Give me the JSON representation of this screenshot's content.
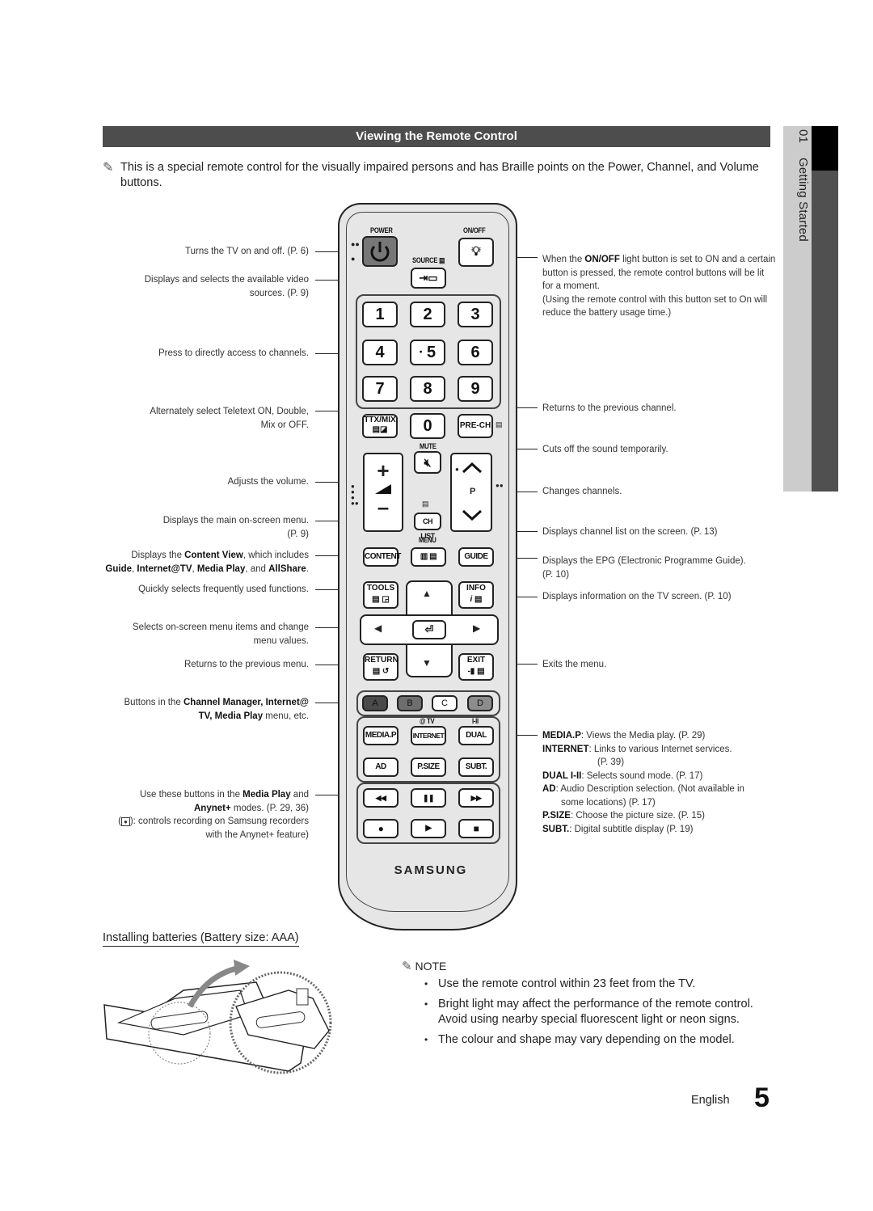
{
  "section": {
    "title": "Viewing the Remote Control",
    "intro_icon": "pencil-note-icon",
    "intro": "This is a special remote control for the visually impaired persons and has Braille points on the Power, Channel, and Volume buttons."
  },
  "side_tab": {
    "chapter_number": "01",
    "chapter_title": "Getting Started"
  },
  "left_callouts": [
    {
      "text": "Turns the TV on and off. (P. 6)"
    },
    {
      "line1": "Displays and selects the available video",
      "line2": "sources. (P. 9)"
    },
    {
      "text": "Press to directly access to channels."
    },
    {
      "line1": "Alternately select Teletext ON, Double,",
      "line2": "Mix or OFF."
    },
    {
      "text": "Adjusts the volume."
    },
    {
      "line1": "Displays the main on-screen menu.",
      "line2": "(P. 9)"
    },
    {
      "pre": "Displays the ",
      "b1": "Content View",
      "mid": ", which includes",
      "b2": "Guide",
      "sep1": ", ",
      "b3": "Internet@TV",
      "sep2": ", ",
      "b4": "Media Play",
      "sep3": ", and ",
      "b5": "AllShare",
      "end": "."
    },
    {
      "text": "Quickly selects frequently used functions."
    },
    {
      "line1": "Selects on-screen menu items and change",
      "line2": "menu values."
    },
    {
      "text": "Returns to the previous menu."
    },
    {
      "pre": "Buttons in the ",
      "b1": "Channel Manager, Internet@",
      "b2": "TV, Media Play",
      "end": " menu, etc."
    },
    {
      "pre": "Use these buttons in the ",
      "b1": "Media Play",
      "mid": " and",
      "b2": "Anynet+",
      "mid2": " modes. (P. 29, 36)",
      "line3": ": controls recording on Samsung recorders",
      "line4": "with the Anynet+ feature)"
    }
  ],
  "right_callouts": [
    {
      "pre": "When the ",
      "b1": "ON/OFF",
      "rest": " light button is set to ON and a certain button is pressed, the remote control buttons will be lit for a moment.",
      "note": "(Using the remote control with this button set to On will reduce the battery usage time.)"
    },
    {
      "text": "Returns to the previous channel."
    },
    {
      "text": "Cuts off the sound temporarily."
    },
    {
      "text": "Changes channels."
    },
    {
      "text": "Displays channel list on the screen. (P. 13)"
    },
    {
      "line1": "Displays the EPG (Electronic Programme Guide).",
      "line2": "(P. 10)"
    },
    {
      "text": "Displays information on the TV screen. (P. 10)"
    },
    {
      "text": "Exits the menu."
    },
    {
      "items": [
        {
          "key": "MEDIA.P",
          "desc": ": Views the Media play. (P. 29)"
        },
        {
          "key": "INTERNET",
          "desc": ": Links to various Internet services.",
          "cont": "(P. 39)"
        },
        {
          "key": "DUAL I-II",
          "desc": ": Selects sound mode. (P. 17)"
        },
        {
          "key": "AD",
          "desc": ": Audio Description selection. (Not available in",
          "cont": "some locations) (P. 17)"
        },
        {
          "key": "P.SIZE",
          "desc": ": Choose the picture size. (P. 15)"
        },
        {
          "key": "SUBT.",
          "desc": ": Digital subtitle display (P. 19)"
        }
      ]
    }
  ],
  "remote": {
    "power_label": "POWER",
    "onoff_label": "ON/OFF",
    "source_label": "SOURCE",
    "numbers": [
      "1",
      "2",
      "3",
      "4",
      "5",
      "6",
      "7",
      "8",
      "9"
    ],
    "zero": "0",
    "ttx_label": "TTX/MIX",
    "prech_label": "PRE-CH",
    "mute_label": "MUTE",
    "ch_label": "P",
    "chlist_label": "CH LIST",
    "menu_label": "MENU",
    "content_label": "CONTENT",
    "guide_label": "GUIDE",
    "tools_label": "TOOLS",
    "info_label": "INFO",
    "return_label": "RETURN",
    "exit_label": "EXIT",
    "color_buttons": [
      {
        "label": "A",
        "color": "#4a4a4a"
      },
      {
        "label": "B",
        "color": "#6e6e6e"
      },
      {
        "label": "C",
        "color": "#ffffff"
      },
      {
        "label": "D",
        "color": "#8c8c8c"
      }
    ],
    "at_tv_label": "@ TV",
    "dual_sub_label": "I-II",
    "media_buttons": [
      "MEDIA.P",
      "INTERNET",
      "DUAL",
      "AD",
      "P.SIZE",
      "SUBT."
    ],
    "playback": {
      "rew": "◀◀",
      "pause": "❚❚",
      "ff": "▶▶",
      "rec": "●",
      "play": "▶",
      "stop": "■"
    },
    "brand": "SAMSUNG"
  },
  "batteries": {
    "title": "Installing batteries (Battery size: AAA)"
  },
  "note": {
    "heading": "NOTE",
    "items": [
      "Use the remote control within 23 feet from the TV.",
      "Bright light may affect the performance of the remote control. Avoid using nearby special fluorescent light or neon signs.",
      "The colour and shape may vary depending on the model."
    ]
  },
  "footer": {
    "language": "English",
    "page_number": "5"
  }
}
